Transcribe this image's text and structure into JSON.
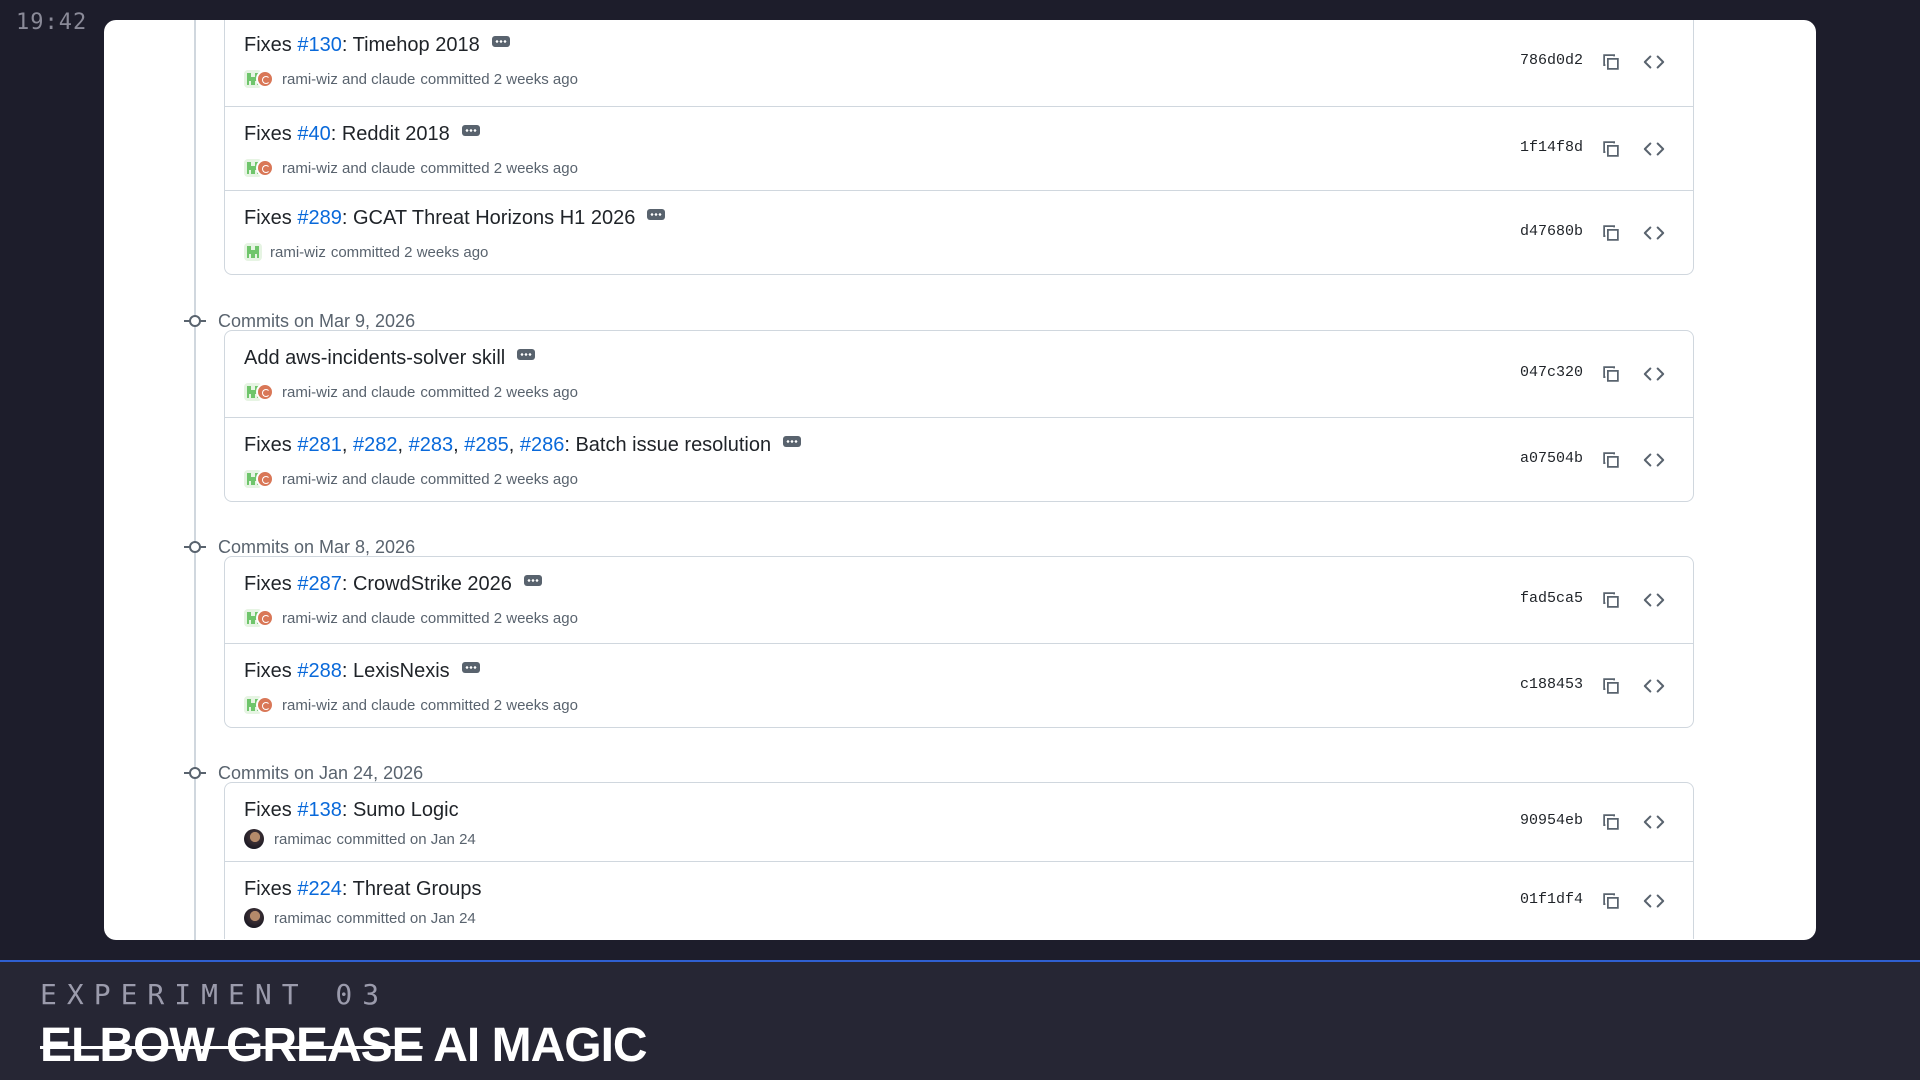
{
  "clock": "19:42",
  "groups": [
    {
      "commits": [
        {
          "prefix": "Fixes ",
          "links": [
            "#130"
          ],
          "separators": [],
          "suffix": ": Timehop 2018",
          "authors": "rami-wiz and claude",
          "when": "committed 2 weeks ago",
          "sha": "786d0d2"
        },
        {
          "prefix": "Fixes ",
          "links": [
            "#40"
          ],
          "separators": [],
          "suffix": ": Reddit 2018",
          "authors": "rami-wiz and claude",
          "when": "committed 2 weeks ago",
          "sha": "1f14f8d"
        },
        {
          "prefix": "Fixes ",
          "links": [
            "#289"
          ],
          "separators": [],
          "suffix": ": GCAT Threat Horizons H1 2026",
          "authors": "rami-wiz",
          "when": "committed 2 weeks ago",
          "sha": "d47680b"
        }
      ]
    },
    {
      "header": "Commits on Mar 9, 2026",
      "commits": [
        {
          "prefix": "Add aws-incidents-solver skill",
          "links": [],
          "separators": [],
          "suffix": "",
          "authors": "rami-wiz and claude",
          "when": "committed 2 weeks ago",
          "sha": "047c320"
        },
        {
          "prefix": "Fixes ",
          "links": [
            "#281",
            "#282",
            "#283",
            "#285",
            "#286"
          ],
          "separators": [
            ", ",
            ", ",
            ", ",
            ", "
          ],
          "suffix": ": Batch issue resolution",
          "authors": "rami-wiz and claude",
          "when": "committed 2 weeks ago",
          "sha": "a07504b"
        }
      ]
    },
    {
      "header": "Commits on Mar 8, 2026",
      "commits": [
        {
          "prefix": "Fixes ",
          "links": [
            "#287"
          ],
          "separators": [],
          "suffix": ": CrowdStrike 2026",
          "authors": "rami-wiz and claude",
          "when": "committed 2 weeks ago",
          "sha": "fad5ca5"
        },
        {
          "prefix": "Fixes ",
          "links": [
            "#288"
          ],
          "separators": [],
          "suffix": ": LexisNexis",
          "authors": "rami-wiz and claude",
          "when": "committed 2 weeks ago",
          "sha": "c188453"
        }
      ]
    },
    {
      "header": "Commits on Jan 24, 2026",
      "commits": [
        {
          "prefix": "Fixes ",
          "links": [
            "#138"
          ],
          "separators": [],
          "suffix": ": Sumo Logic",
          "authors": "ramimac",
          "when": "committed on Jan 24",
          "sha": "90954eb"
        },
        {
          "prefix": "Fixes ",
          "links": [
            "#224"
          ],
          "separators": [],
          "suffix": ": Threat Groups",
          "authors": "ramimac",
          "when": "committed on Jan 24",
          "sha": "01f1df4"
        }
      ]
    }
  ],
  "footer": {
    "label": "EXPERIMENT 03",
    "struck": "ELBOW GREASE",
    "headline": "AI MAGIC"
  },
  "colors": {
    "link": "#0969da",
    "text": "#1f2328",
    "muted": "#59636e",
    "accent_line": "#2f5fd0"
  },
  "icons": {
    "copy": "copy-icon",
    "browse": "code-icon",
    "ellipsis": "ellipsis-icon",
    "commit": "git-commit-icon"
  }
}
